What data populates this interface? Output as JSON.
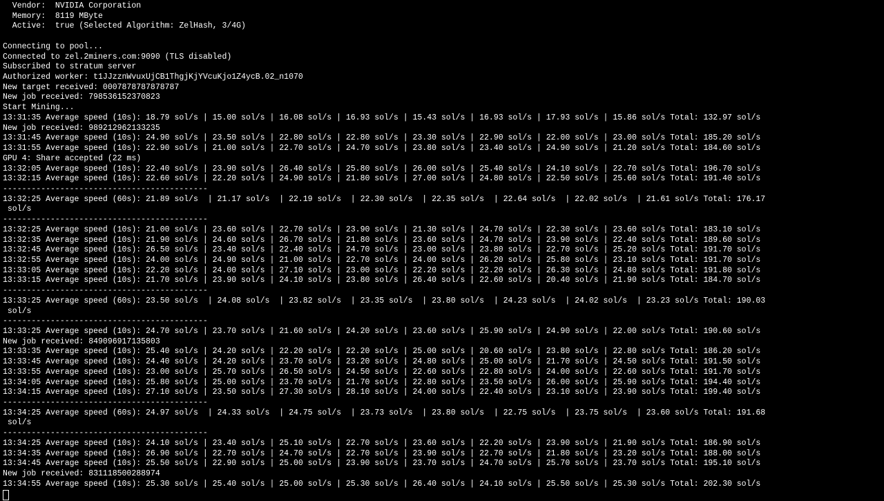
{
  "header": {
    "vendor_label": "  Vendor:",
    "vendor": "NVIDIA Corporation",
    "memory_label": "  Memory:",
    "memory": "8119 MByte",
    "active_label": "  Active:",
    "active": "true (Selected Algorithm: ZelHash, 3/4G)"
  },
  "connection": [
    "Connecting to pool...",
    "Connected to zel.2miners.com:9090 (TLS disabled)",
    "Subscribed to stratum server",
    "Authorized worker: t1JJzznWvuxUjCB1ThgjKjYVcuKjo1Z4ycB.02_n1070",
    "New target received: 0007878787878787",
    "New job received: 798536152370823",
    "Start Mining..."
  ],
  "lines": [
    {
      "t": "avg10",
      "time": "13:31:35",
      "v": [
        "18.79",
        "15.00",
        "16.08",
        "16.93",
        "15.43",
        "16.93",
        "17.93",
        "15.86"
      ],
      "total": "132.97"
    },
    {
      "t": "job",
      "text": "New job received: 989212962133235"
    },
    {
      "t": "avg10",
      "time": "13:31:45",
      "v": [
        "24.90",
        "23.50",
        "22.80",
        "22.80",
        "23.30",
        "22.90",
        "22.00",
        "23.00"
      ],
      "total": "185.20"
    },
    {
      "t": "avg10",
      "time": "13:31:55",
      "v": [
        "22.90",
        "21.00",
        "22.70",
        "24.70",
        "23.80",
        "23.40",
        "24.90",
        "21.20"
      ],
      "total": "184.60"
    },
    {
      "t": "raw",
      "text": "GPU 4: Share accepted (22 ms)"
    },
    {
      "t": "avg10",
      "time": "13:32:05",
      "v": [
        "22.40",
        "23.90",
        "26.40",
        "25.80",
        "26.00",
        "25.40",
        "24.10",
        "22.70"
      ],
      "total": "196.70"
    },
    {
      "t": "avg10",
      "time": "13:32:15",
      "v": [
        "22.60",
        "22.20",
        "24.90",
        "21.80",
        "27.00",
        "24.80",
        "22.50",
        "25.60"
      ],
      "total": "191.40"
    },
    {
      "t": "sep"
    },
    {
      "t": "avg60",
      "time": "13:32:25",
      "v": [
        "21.89",
        "21.17",
        "22.19",
        "22.30",
        "22.35",
        "22.64",
        "22.02",
        "21.61"
      ],
      "total": "176.17"
    },
    {
      "t": "sep"
    },
    {
      "t": "avg10",
      "time": "13:32:25",
      "v": [
        "21.00",
        "23.60",
        "22.70",
        "23.90",
        "21.30",
        "24.70",
        "22.30",
        "23.60"
      ],
      "total": "183.10"
    },
    {
      "t": "avg10",
      "time": "13:32:35",
      "v": [
        "21.90",
        "24.60",
        "26.70",
        "21.80",
        "23.60",
        "24.70",
        "23.90",
        "22.40"
      ],
      "total": "189.60"
    },
    {
      "t": "avg10",
      "time": "13:32:45",
      "v": [
        "26.50",
        "23.40",
        "22.40",
        "24.70",
        "23.00",
        "23.80",
        "22.70",
        "25.20"
      ],
      "total": "191.70"
    },
    {
      "t": "avg10",
      "time": "13:32:55",
      "v": [
        "24.00",
        "24.90",
        "21.00",
        "22.70",
        "24.00",
        "26.20",
        "25.80",
        "23.10"
      ],
      "total": "191.70"
    },
    {
      "t": "avg10",
      "time": "13:33:05",
      "v": [
        "22.20",
        "24.00",
        "27.10",
        "23.00",
        "22.20",
        "22.20",
        "26.30",
        "24.80"
      ],
      "total": "191.80"
    },
    {
      "t": "avg10",
      "time": "13:33:15",
      "v": [
        "21.70",
        "23.90",
        "24.10",
        "23.80",
        "26.40",
        "22.60",
        "20.40",
        "21.90"
      ],
      "total": "184.70"
    },
    {
      "t": "sep"
    },
    {
      "t": "avg60",
      "time": "13:33:25",
      "v": [
        "23.50",
        "24.08",
        "23.82",
        "23.35",
        "23.80",
        "24.23",
        "24.02",
        "23.23"
      ],
      "total": "190.03"
    },
    {
      "t": "sep"
    },
    {
      "t": "avg10",
      "time": "13:33:25",
      "v": [
        "24.70",
        "23.70",
        "21.60",
        "24.20",
        "23.60",
        "25.90",
        "24.90",
        "22.00"
      ],
      "total": "190.60"
    },
    {
      "t": "job",
      "text": "New job received: 849096917135803"
    },
    {
      "t": "avg10",
      "time": "13:33:35",
      "v": [
        "25.40",
        "24.20",
        "22.20",
        "22.20",
        "25.00",
        "20.60",
        "23.80",
        "22.80"
      ],
      "total": "186.20"
    },
    {
      "t": "avg10",
      "time": "13:33:45",
      "v": [
        "24.40",
        "24.20",
        "23.70",
        "23.20",
        "24.80",
        "25.00",
        "21.70",
        "24.50"
      ],
      "total": "191.50"
    },
    {
      "t": "avg10",
      "time": "13:33:55",
      "v": [
        "23.00",
        "25.70",
        "26.50",
        "24.50",
        "22.60",
        "22.80",
        "24.00",
        "22.60"
      ],
      "total": "191.70"
    },
    {
      "t": "avg10",
      "time": "13:34:05",
      "v": [
        "25.80",
        "25.00",
        "23.70",
        "21.70",
        "22.80",
        "23.50",
        "26.00",
        "25.90"
      ],
      "total": "194.40"
    },
    {
      "t": "avg10",
      "time": "13:34:15",
      "v": [
        "27.10",
        "23.50",
        "27.30",
        "28.10",
        "24.00",
        "22.40",
        "23.10",
        "23.90"
      ],
      "total": "199.40"
    },
    {
      "t": "sep"
    },
    {
      "t": "avg60",
      "time": "13:34:25",
      "v": [
        "24.97",
        "24.33",
        "24.75",
        "23.73",
        "23.80",
        "22.75",
        "23.75",
        "23.60"
      ],
      "total": "191.68"
    },
    {
      "t": "sep"
    },
    {
      "t": "avg10",
      "time": "13:34:25",
      "v": [
        "24.10",
        "23.40",
        "25.10",
        "22.70",
        "23.60",
        "22.20",
        "23.90",
        "21.90"
      ],
      "total": "186.90"
    },
    {
      "t": "avg10",
      "time": "13:34:35",
      "v": [
        "26.90",
        "22.70",
        "24.70",
        "22.70",
        "23.90",
        "22.70",
        "21.80",
        "23.20"
      ],
      "total": "188.00"
    },
    {
      "t": "avg10",
      "time": "13:34:45",
      "v": [
        "25.50",
        "22.90",
        "25.00",
        "23.90",
        "23.70",
        "24.70",
        "25.70",
        "23.70"
      ],
      "total": "195.10"
    },
    {
      "t": "job",
      "text": "New job received: 831118500288974"
    },
    {
      "t": "avg10",
      "time": "13:34:55",
      "v": [
        "25.30",
        "25.40",
        "25.00",
        "25.30",
        "26.40",
        "24.10",
        "25.50",
        "25.30"
      ],
      "total": "202.30"
    }
  ],
  "labels": {
    "avg10_prefix": "Average speed (10s): ",
    "avg60_prefix": "Average speed (60s): ",
    "unit": "sol/s",
    "total": "Total:"
  },
  "separator": "-------------------------------------------"
}
